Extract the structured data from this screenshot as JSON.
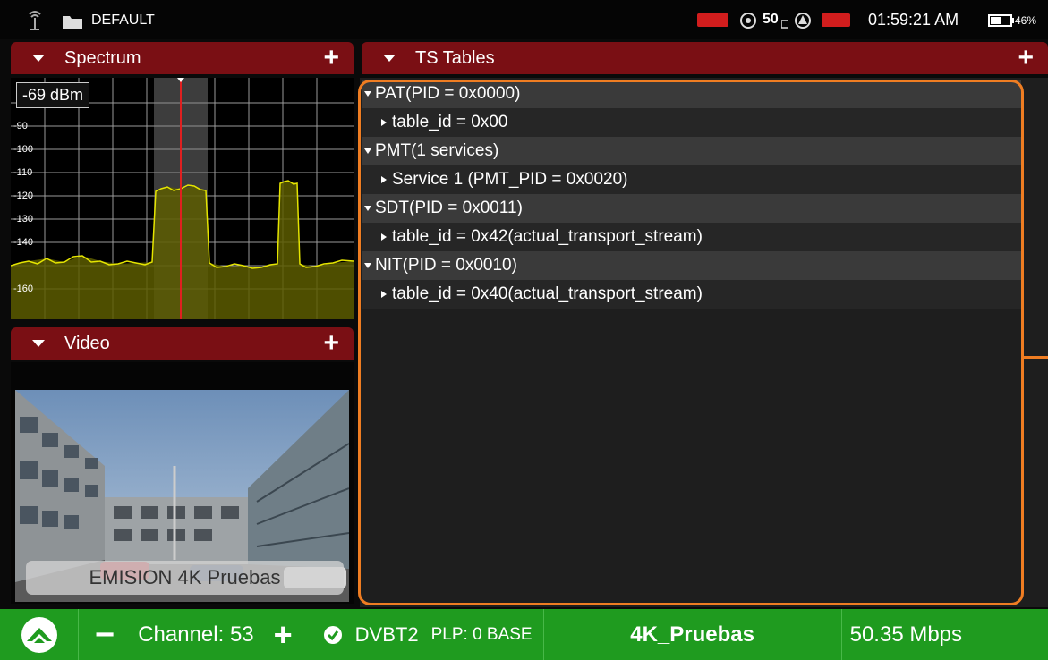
{
  "status": {
    "profile": "DEFAULT",
    "num_badge": "50",
    "time": "01:59:21 AM",
    "battery": "46%",
    "icons": [
      "antenna-icon",
      "folder-icon",
      "record-badge-icon",
      "satellite-icon",
      "dolby-icon",
      "alert-icon",
      "ur-badge-icon",
      "battery-icon"
    ]
  },
  "spectrum": {
    "title": "Spectrum",
    "level_readout": "-69 dBm",
    "y_labels": [
      "-90",
      "-100",
      "-110",
      "-120",
      "-130",
      "-140",
      "-160"
    ],
    "colors": {
      "trace": "#e5e500",
      "fill": "#5c5c00",
      "marker": "#e02020"
    }
  },
  "video": {
    "title": "Video",
    "caption": "EMISION 4K Pruebas"
  },
  "ts": {
    "title": "TS Tables",
    "rows": [
      {
        "label": "PAT(PID = 0x0000)",
        "level": 0
      },
      {
        "label": "table_id = 0x00",
        "level": 1
      },
      {
        "label": "PMT(1 services)",
        "level": 0
      },
      {
        "label": "Service 1 (PMT_PID = 0x0020)",
        "level": 1
      },
      {
        "label": "SDT(PID = 0x0011)",
        "level": 0
      },
      {
        "label": "table_id = 0x42(actual_transport_stream)",
        "level": 1
      },
      {
        "label": "NIT(PID = 0x0010)",
        "level": 0
      },
      {
        "label": "table_id = 0x40(actual_transport_stream)",
        "level": 1
      }
    ]
  },
  "bottom": {
    "minus": "−",
    "channel_label": "Channel: 53",
    "plus": "+",
    "standard": "DVBT2",
    "plp": "PLP: 0 BASE",
    "service": "4K_Pruebas",
    "bitrate": "50.35 Mbps"
  },
  "colors": {
    "accent": "#ef7d22",
    "panel_header": "#7a0f14",
    "bottom_bar": "#1f9b1f"
  }
}
